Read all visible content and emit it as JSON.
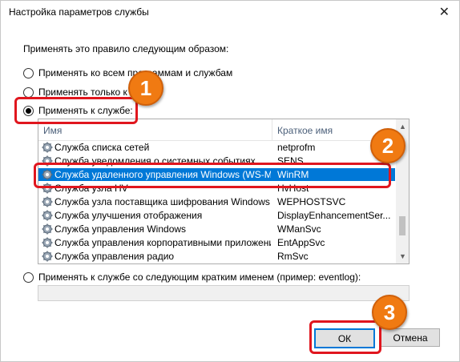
{
  "window": {
    "title": "Настройка параметров службы"
  },
  "prompt": "Применять это правило следующим образом:",
  "options": {
    "all": "Применять ко всем программам и службам",
    "only": "Применять только к с",
    "service": "Применять к службе:",
    "short": "Применять к службе со следующим кратким именем (пример: eventlog):"
  },
  "list": {
    "col_name": "Имя",
    "col_short": "Краткое имя",
    "rows": [
      {
        "name": "Служба списка сетей",
        "short": "netprofm"
      },
      {
        "name": "Служба уведомления о системных событиях",
        "short": "SENS"
      },
      {
        "name": "Служба удаленного управления Windows (WS-Man...",
        "short": "WinRM"
      },
      {
        "name": "Служба узла HV",
        "short": "HvHost"
      },
      {
        "name": "Служба узла поставщика шифрования Windows",
        "short": "WEPHOSTSVC"
      },
      {
        "name": "Служба улучшения отображения",
        "short": "DisplayEnhancementSer..."
      },
      {
        "name": "Служба управления Windows",
        "short": "WManSvc"
      },
      {
        "name": "Служба управления корпоративными приложения...",
        "short": "EntAppSvc"
      },
      {
        "name": "Служба управления радио",
        "short": "RmSvc"
      }
    ]
  },
  "short_name_value": "",
  "buttons": {
    "ok": "ОК",
    "cancel": "Отмена"
  },
  "badges": [
    "1",
    "2",
    "3"
  ],
  "colors": {
    "selection": "#0078d7",
    "highlight": "#e0161e",
    "badge": "#f07a12"
  }
}
